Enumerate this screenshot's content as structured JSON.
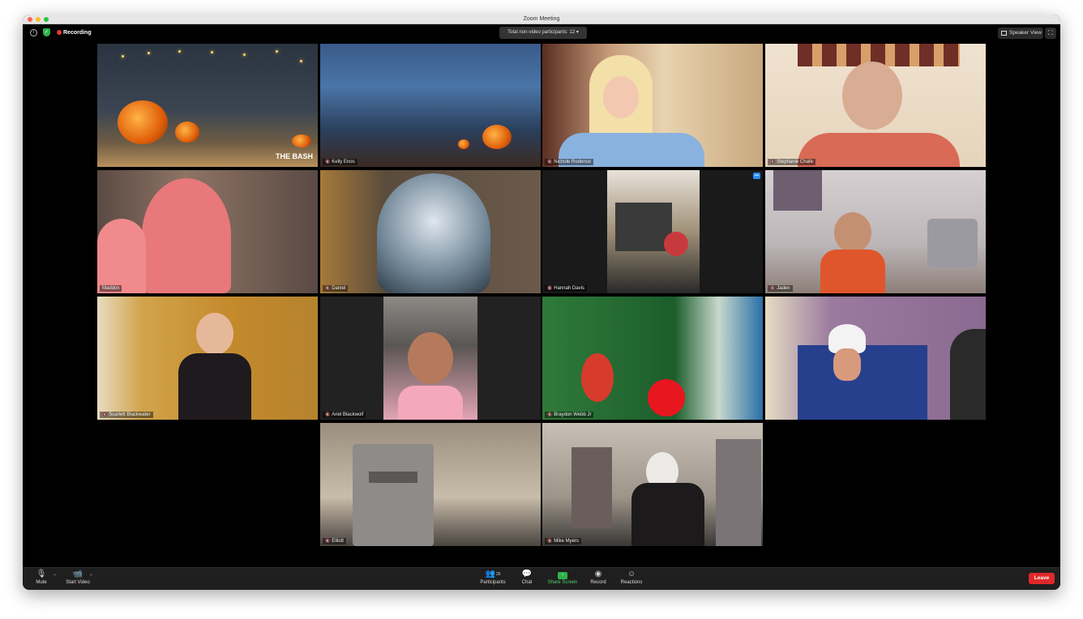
{
  "window": {
    "title": "Zoom Meeting"
  },
  "topbar": {
    "recording_label": "Recording",
    "nonvideo_label": "Total non-video participants: 12",
    "speaker_view_label": "Speaker View"
  },
  "tiles": [
    {
      "name": "",
      "overlay_text": "THE BASH"
    },
    {
      "name": "Kelly Enos"
    },
    {
      "name": "Nichole Rodence"
    },
    {
      "name": "Stephanie Chafe"
    },
    {
      "name": "Maddox"
    },
    {
      "name": "Daniel"
    },
    {
      "name": "Hannah Davis"
    },
    {
      "name": "Jaden"
    },
    {
      "name": "Scarlett Blackwater"
    },
    {
      "name": "Ariel Blackwolf"
    },
    {
      "name": "Braydon Webb Jr"
    },
    {
      "name": ""
    },
    {
      "name": "Elliott"
    },
    {
      "name": "Mike Myers"
    }
  ],
  "toolbar": {
    "mute_label": "Mute",
    "start_video_label": "Start Video",
    "participants_label": "Participants",
    "participants_count": "26",
    "chat_label": "Chat",
    "share_label": "Share Screen",
    "record_label": "Record",
    "reactions_label": "Reactions",
    "leave_label": "Leave"
  },
  "icons": [
    "info-icon",
    "shield-icon",
    "microphone-icon",
    "video-off-icon",
    "participants-icon",
    "chat-icon",
    "share-screen-icon",
    "record-icon",
    "reactions-icon",
    "fullscreen-icon"
  ],
  "colors": {
    "recording": "#e23b3b",
    "leave": "#e02828",
    "share": "#2fb34a",
    "accent": "#2d8cff"
  }
}
